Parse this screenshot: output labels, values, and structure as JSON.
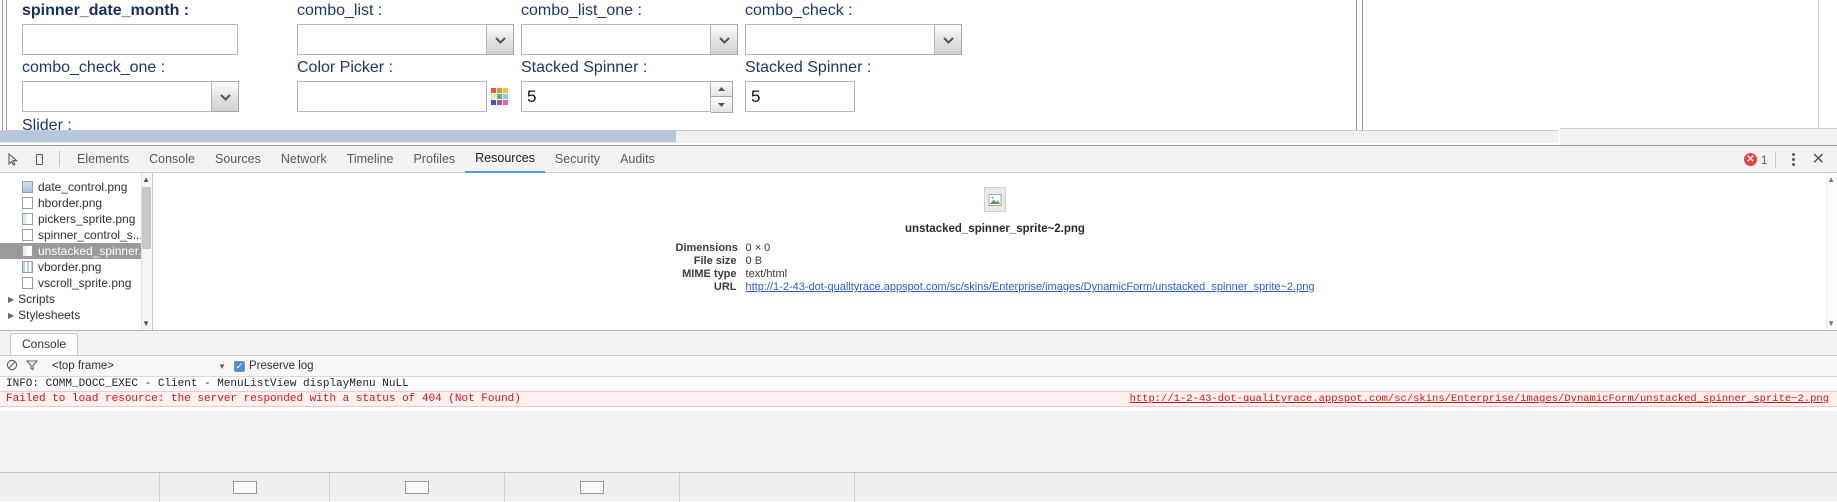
{
  "page_form": {
    "fields": [
      {
        "label": "spinner_date_month :",
        "type": "text",
        "value": "",
        "bold": true
      },
      {
        "label": "combo_list :",
        "type": "combo",
        "value": ""
      },
      {
        "label": "combo_list_one :",
        "type": "combo",
        "value": ""
      },
      {
        "label": "combo_check :",
        "type": "combo",
        "value": ""
      },
      {
        "label": "combo_check_one :",
        "type": "combo",
        "value": ""
      },
      {
        "label": "Color Picker :",
        "type": "colorpicker",
        "value": ""
      },
      {
        "label": "Stacked Spinner :",
        "type": "spinner",
        "value": "5"
      },
      {
        "label": "Stacked Spinner :",
        "type": "spinner_plain",
        "value": "5"
      }
    ],
    "partial_label": "Slider :"
  },
  "devtools": {
    "tabs": [
      {
        "label": "Elements",
        "active": false
      },
      {
        "label": "Console",
        "active": false
      },
      {
        "label": "Sources",
        "active": false
      },
      {
        "label": "Network",
        "active": false
      },
      {
        "label": "Timeline",
        "active": false
      },
      {
        "label": "Profiles",
        "active": false
      },
      {
        "label": "Resources",
        "active": true
      },
      {
        "label": "Security",
        "active": false
      },
      {
        "label": "Audits",
        "active": false
      }
    ],
    "error_count": "1",
    "sidebar": {
      "files": [
        {
          "name": "date_control.png",
          "selected": false
        },
        {
          "name": "hborder.png",
          "selected": false
        },
        {
          "name": "pickers_sprite.png",
          "selected": false
        },
        {
          "name": "spinner_control_s...",
          "selected": false
        },
        {
          "name": "unstacked_spinner...",
          "selected": true
        },
        {
          "name": "vborder.png",
          "selected": false
        },
        {
          "name": "vscroll_sprite.png",
          "selected": false
        }
      ],
      "groups": [
        {
          "name": "Scripts"
        },
        {
          "name": "Stylesheets"
        }
      ]
    },
    "resource_detail": {
      "filename": "unstacked_spinner_sprite~2.png",
      "meta": [
        {
          "key": "Dimensions",
          "value": "0 × 0"
        },
        {
          "key": "File size",
          "value": "0 B"
        },
        {
          "key": "MIME type",
          "value": "text/html"
        },
        {
          "key": "URL",
          "value": "http://1-2-43-dot-qualityrace.appspot.com/sc/skins/Enterprise/images/DynamicForm/unstacked_spinner_sprite~2.png",
          "link": true
        }
      ]
    },
    "drawer": {
      "tab_label": "Console",
      "frame_selector": "<top frame>",
      "preserve_log_label": "Preserve log",
      "preserve_log_checked": true,
      "messages": [
        {
          "type": "info",
          "text": "INFO: COMM_DOCC_EXEC - Client - MenuListView displayMenu NuLL",
          "source": ""
        },
        {
          "type": "error",
          "text": "Failed to load resource: the server responded with a status of 404 (Not Found)",
          "source": "http://1-2-43-dot-qualityrace.appspot.com/sc/skins/Enterprise/images/DynamicForm/unstacked_spinner_sprite~2.png"
        }
      ]
    }
  },
  "colors": {
    "accent_blue": "#5a9bd4",
    "error_red": "#d61414",
    "link_blue": "#2b5fc9",
    "label_navy": "#1b3a6b",
    "selected_gray": "#9a9a9a"
  }
}
